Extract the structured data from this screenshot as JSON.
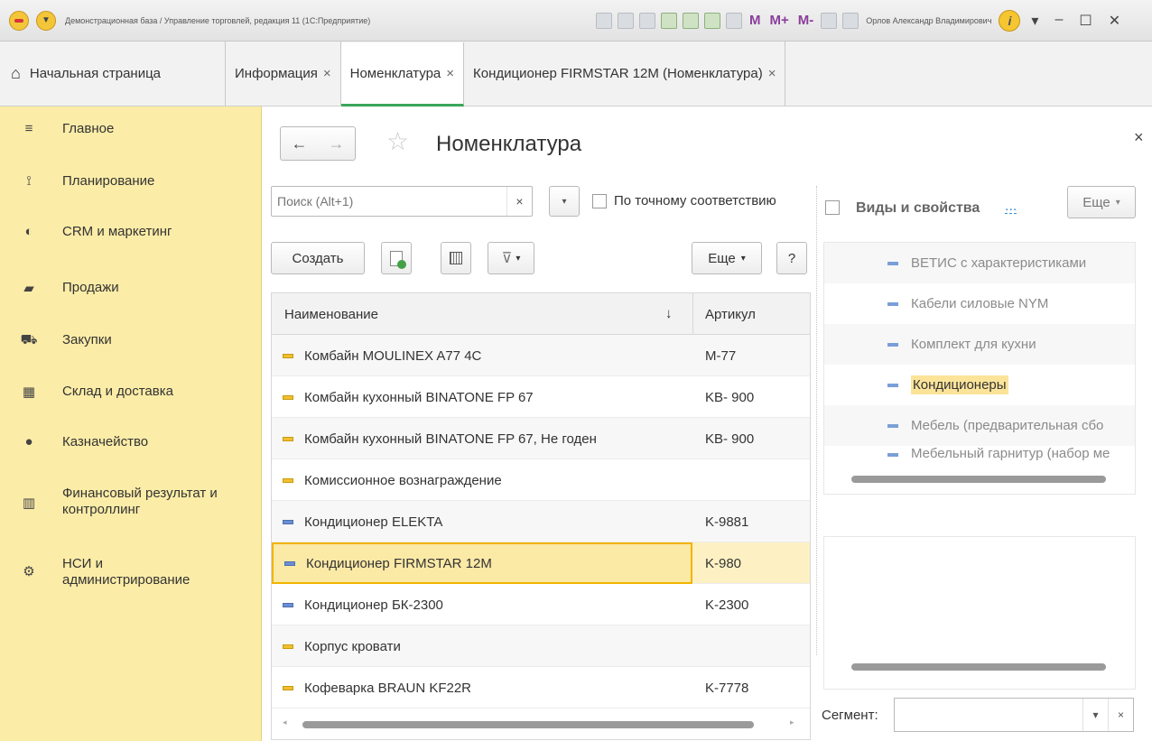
{
  "window": {
    "title": "Демонстрационная база / Управление торговлей, редакция 11 (1С:Предприятие)",
    "user": "Орлов Александр Владимирович",
    "marks": [
      "M",
      "M+",
      "M-"
    ]
  },
  "tabs": [
    {
      "label": "Начальная страница"
    },
    {
      "label": "Информация",
      "close": "×"
    },
    {
      "label": "Номенклатура",
      "close": "×"
    },
    {
      "label": "Кондиционер FIRMSTAR 12M (Номенклатура)",
      "close": "×"
    }
  ],
  "sidebar": {
    "items": [
      {
        "label": "Главное",
        "icon": "menu-icon"
      },
      {
        "label": "Планирование",
        "icon": "planning-icon"
      },
      {
        "label": "CRM и маркетинг",
        "icon": "crm-icon"
      },
      {
        "label": "Продажи",
        "icon": "bag-icon"
      },
      {
        "label": "Закупки",
        "icon": "cart-icon"
      },
      {
        "label": "Склад и доставка",
        "icon": "warehouse-icon"
      },
      {
        "label": "Казначейство",
        "icon": "treasury-icon"
      },
      {
        "label": "Финансовый результат и контроллинг",
        "icon": "chart-icon"
      },
      {
        "label": "НСИ и администрирование",
        "icon": "gear-icon"
      }
    ]
  },
  "page": {
    "title": "Номенклатура",
    "close": "×"
  },
  "search": {
    "placeholder": "Поиск (Alt+1)",
    "clear": "×",
    "exact_label": "По точному соответствию"
  },
  "toolbar": {
    "create": "Создать",
    "more": "Еще",
    "help": "?"
  },
  "grid": {
    "headers": {
      "name": "Наименование",
      "sort": "↓",
      "article": "Артикул"
    },
    "rows": [
      {
        "name": "Комбайн MOULINEX  A77 4C",
        "article": "M-77"
      },
      {
        "name": "Комбайн кухонный BINATONE FP 67",
        "article": "KB- 900"
      },
      {
        "name": "Комбайн кухонный BINATONE FP 67, Не годен",
        "article": "KB- 900"
      },
      {
        "name": "Комиссионное вознаграждение",
        "article": ""
      },
      {
        "name": "Кондиционер ELEKTA",
        "article": "K-9881"
      },
      {
        "name": "Кондиционер FIRMSTAR 12M",
        "article": "K-980"
      },
      {
        "name": "Кондиционер БК-2300",
        "article": "K-2300"
      },
      {
        "name": "Корпус кровати",
        "article": ""
      },
      {
        "name": "Кофеварка BRAUN KF22R",
        "article": "K-7778"
      }
    ]
  },
  "right_panel": {
    "title": "Виды и свойства",
    "dots": "...",
    "more": "Еще",
    "items": [
      "ВЕТИС с характеристиками",
      "Кабели силовые NYM",
      "Комплект для кухни",
      "Кондиционеры",
      "Мебель (предварительная сбо",
      "Мебельный гарнитур (набор ме"
    ],
    "segment_label": "Сегмент:"
  }
}
